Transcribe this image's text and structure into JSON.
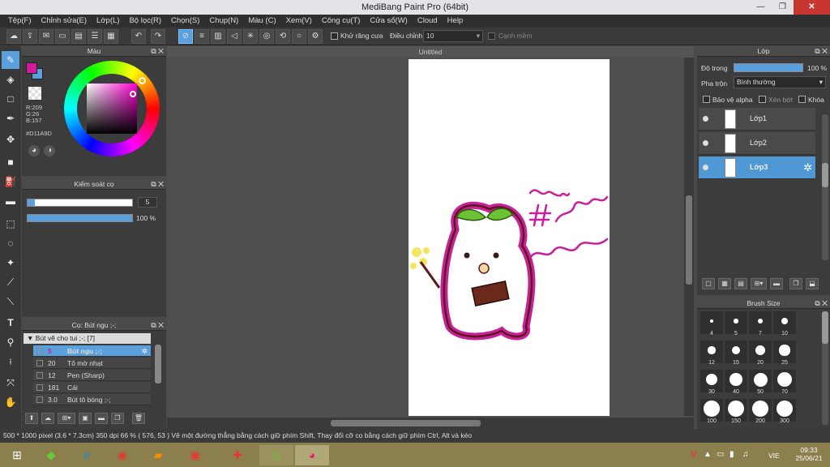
{
  "window": {
    "title": "MediBang Paint Pro (64bit)",
    "minimize": "—",
    "restore": "❐",
    "close": "✕"
  },
  "menu": [
    "Tệp(F)",
    "Chỉnh sửa(E)",
    "Lớp(L)",
    "Bộ lọc(R)",
    "Chọn(S)",
    "Chụp(N)",
    "Màu (C)",
    "Xem(V)",
    "Công cụ(T)",
    "Cửa sổ(W)",
    "Cloud",
    "Help"
  ],
  "toolbar": {
    "antialias_label": "Khử răng cưa",
    "adjust_label": "Điều chỉnh",
    "adjust_value": "10",
    "smooth_label": "Cạnh mềm"
  },
  "color_panel": {
    "title": "Màu",
    "r": "R:209",
    "g": "G:26",
    "b": "B:157",
    "hex": "#D11A9D",
    "primary_color": "#D11A9D"
  },
  "brush_control": {
    "title": "Kiểm soát cọ",
    "size_value": "5",
    "opacity_value": "100 %"
  },
  "brush_panel": {
    "title": "Cọ: Bút ngu ;-;",
    "group": "Bút vẽ cho tui ;-; [7]",
    "items": [
      {
        "size": "5",
        "name": "Bút ngu ;-;",
        "selected": true
      },
      {
        "size": "20",
        "name": "Tô mờ nhạt"
      },
      {
        "size": "12",
        "name": "Pen (Sharp)"
      },
      {
        "size": "181",
        "name": "Cái"
      },
      {
        "size": "3.0",
        "name": "Bút tô bóng ;-;"
      }
    ]
  },
  "canvas": {
    "tab_title": "Untitled"
  },
  "layer_panel": {
    "title": "Lớp",
    "opacity_label": "Độ trong",
    "opacity_value": "100 %",
    "blend_label": "Pha trộn",
    "blend_value": "Bình thường",
    "protect_alpha": "Bảo vệ alpha",
    "clipping": "Xén bớt",
    "lock": "Khóa",
    "layers": [
      {
        "name": "Lớp1",
        "selected": false
      },
      {
        "name": "Lớp2",
        "selected": false
      },
      {
        "name": "Lớp3",
        "selected": true
      }
    ]
  },
  "brush_size_panel": {
    "title": "Brush Size",
    "sizes": [
      "4",
      "5",
      "7",
      "10",
      "12",
      "15",
      "20",
      "25",
      "30",
      "40",
      "50",
      "70",
      "100",
      "150",
      "200",
      "300"
    ]
  },
  "status": {
    "text": "500 * 1000 pixel   (3.6 * 7.3cm)   350 dpi   66 %   ( 576, 53 )   Vẽ một đường thẳng bằng cách giữ phím Shift, Thay đổi cỡ cọ bằng cách giữ phím Ctrl, Alt và kéo"
  },
  "taskbar": {
    "lang": "VIE",
    "time": "09:33",
    "date": "25/06/21"
  }
}
